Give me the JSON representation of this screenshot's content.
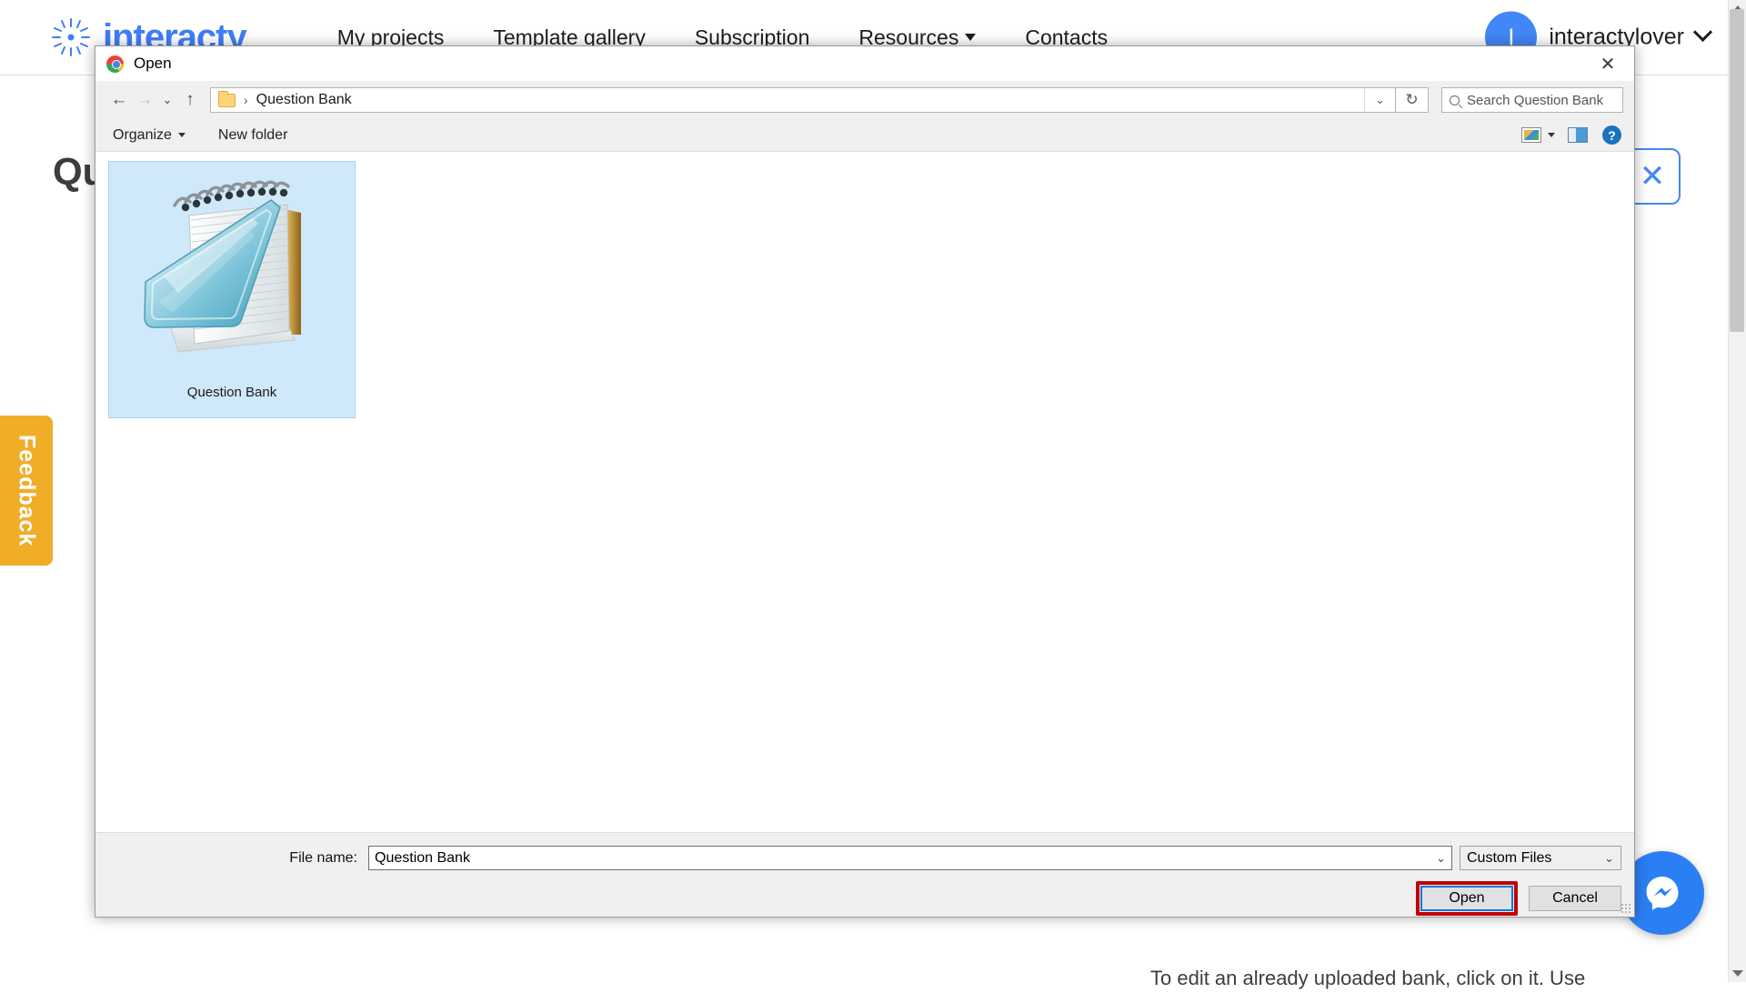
{
  "site": {
    "brand": "interacty",
    "brand_color": "#3f7dfb",
    "brand_mark_icon": "sunburst-logo-icon",
    "nav": [
      {
        "label": "My projects",
        "has_caret": false
      },
      {
        "label": "Template gallery",
        "has_caret": false
      },
      {
        "label": "Subscription",
        "has_caret": false
      },
      {
        "label": "Resources",
        "has_caret": true
      },
      {
        "label": "Contacts",
        "has_caret": false
      }
    ],
    "user": {
      "avatar_initial": "I",
      "avatar_color": "#4287f5",
      "name": "interactylover"
    },
    "page_title": "Question Bank",
    "close_label": "✕",
    "feedback_label": "Feedback",
    "feedback_color": "#f0ad28",
    "card_hint": "To edit an already uploaded bank, click on it. Use",
    "messenger_icon": "messenger-icon"
  },
  "dialog": {
    "title": "Open",
    "title_icon": "chrome-logo-icon",
    "close_icon": "✕",
    "nav": {
      "back_icon": "←",
      "forward_icon": "→",
      "recent_icon": "⌄",
      "up_icon": "↑"
    },
    "address": {
      "folder_icon": "folder-icon",
      "separator": "›",
      "crumb": "Question Bank",
      "dropdown_icon": "⌄",
      "refresh_icon": "↻"
    },
    "search": {
      "icon": "search-icon",
      "placeholder": "Search Question Bank"
    },
    "toolbar": {
      "organize": "Organize",
      "new_folder": "New folder",
      "view_icon": "view-mode-icon",
      "view_caret": "▾",
      "preview_pane_icon": "preview-pane-icon",
      "help_icon": "?"
    },
    "files": [
      {
        "name": "Question Bank",
        "icon": "notepad-document-icon",
        "selected": true
      }
    ],
    "footer": {
      "file_name_label": "File name:",
      "file_name_value": "Question Bank",
      "file_name_dropdown_icon": "⌄",
      "file_type_value": "Custom Files",
      "file_type_caret": "⌄",
      "open_button": "Open",
      "cancel_button": "Cancel",
      "highlight_color": "#c00000",
      "focus_color": "#0078d7"
    }
  }
}
